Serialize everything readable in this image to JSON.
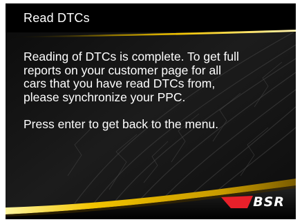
{
  "screen": {
    "title": "Read DTCs",
    "message_paragraphs": [
      "Reading of DTCs is complete. To get full\nreports on your customer page for all\ncars that you have read DTCs from,\nplease synchronize your PPC.",
      "Press enter to get back to the menu."
    ]
  },
  "brand": {
    "logo_text": "BSR",
    "logo_accent_color": "#e8202a",
    "swoosh_color": "#f2c400"
  }
}
